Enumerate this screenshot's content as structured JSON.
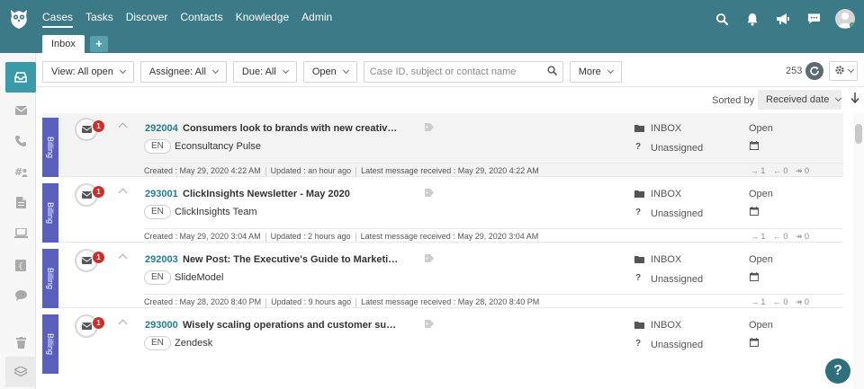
{
  "nav": {
    "items": [
      {
        "label": "Cases",
        "active": true
      },
      {
        "label": "Tasks"
      },
      {
        "label": "Discover"
      },
      {
        "label": "Contacts"
      },
      {
        "label": "Knowledge"
      },
      {
        "label": "Admin"
      }
    ]
  },
  "tabs": {
    "inbox": "Inbox",
    "add": "+"
  },
  "top_icons": [
    "search-icon",
    "bell-icon",
    "megaphone-icon",
    "chat-icon",
    "user-avatar"
  ],
  "sidebar": [
    "inbox-icon",
    "envelope-icon",
    "phone-icon",
    "hashtag-user-icon",
    "document-icon",
    "laptop-icon",
    "bracket-icon",
    "comment-icon",
    "trash-icon",
    "layers-icon"
  ],
  "filters": {
    "view": "View: All open",
    "assignee": "Assignee: All",
    "due": "Due: All",
    "status": "Open",
    "search_placeholder": "Case ID, subject or contact name",
    "more": "More"
  },
  "count": "253",
  "sort": {
    "label": "Sorted by",
    "value": "Received date"
  },
  "cases": [
    {
      "category": "Billing",
      "badge": "1",
      "id": "292004",
      "subject": "Consumers look to brands with new creative pur...",
      "lang": "EN",
      "contact": "Econsultancy Pulse",
      "folder": "INBOX",
      "assignee": "Unassigned",
      "status": "Open",
      "created": "Created : May 29, 2020 4:22 AM",
      "updated": "Updated : an hour ago",
      "latest": "Latest message received : May 29, 2020 4:22 AM",
      "in": "1",
      "out": "0",
      "fwd": "0"
    },
    {
      "category": "Billing",
      "badge": "1",
      "id": "293001",
      "subject": "ClickInsights Newsletter - May 2020",
      "lang": "EN",
      "contact": "ClickInsights Team",
      "folder": "INBOX",
      "assignee": "Unassigned",
      "status": "Open",
      "created": "Created : May 29, 2020 3:04 AM",
      "updated": "Updated : 2 hours ago",
      "latest": "Latest message received : May 29, 2020 3:04 AM",
      "in": "1",
      "out": "0",
      "fwd": "0"
    },
    {
      "category": "Billing",
      "badge": "1",
      "id": "292003",
      "subject": "New Post: The Executive's Guide to Marketing Au...",
      "lang": "EN",
      "contact": "SlideModel",
      "folder": "INBOX",
      "assignee": "Unassigned",
      "status": "Open",
      "created": "Created : May 28, 2020 8:40 PM",
      "updated": "Updated : 9 hours ago",
      "latest": "Latest message received : May 28, 2020 8:40 PM",
      "in": "1",
      "out": "0",
      "fwd": "0"
    },
    {
      "category": "Billing",
      "badge": "1",
      "id": "293000",
      "subject": "Wisely scaling operations and customer support",
      "lang": "EN",
      "contact": "Zendesk",
      "folder": "INBOX",
      "assignee": "Unassigned",
      "status": "Open"
    }
  ],
  "help": "?",
  "colors": {
    "topbar": "#3b7a86",
    "accent": "#2a7b8a",
    "category": "#5a5fbe",
    "badge": "#c9302c"
  }
}
